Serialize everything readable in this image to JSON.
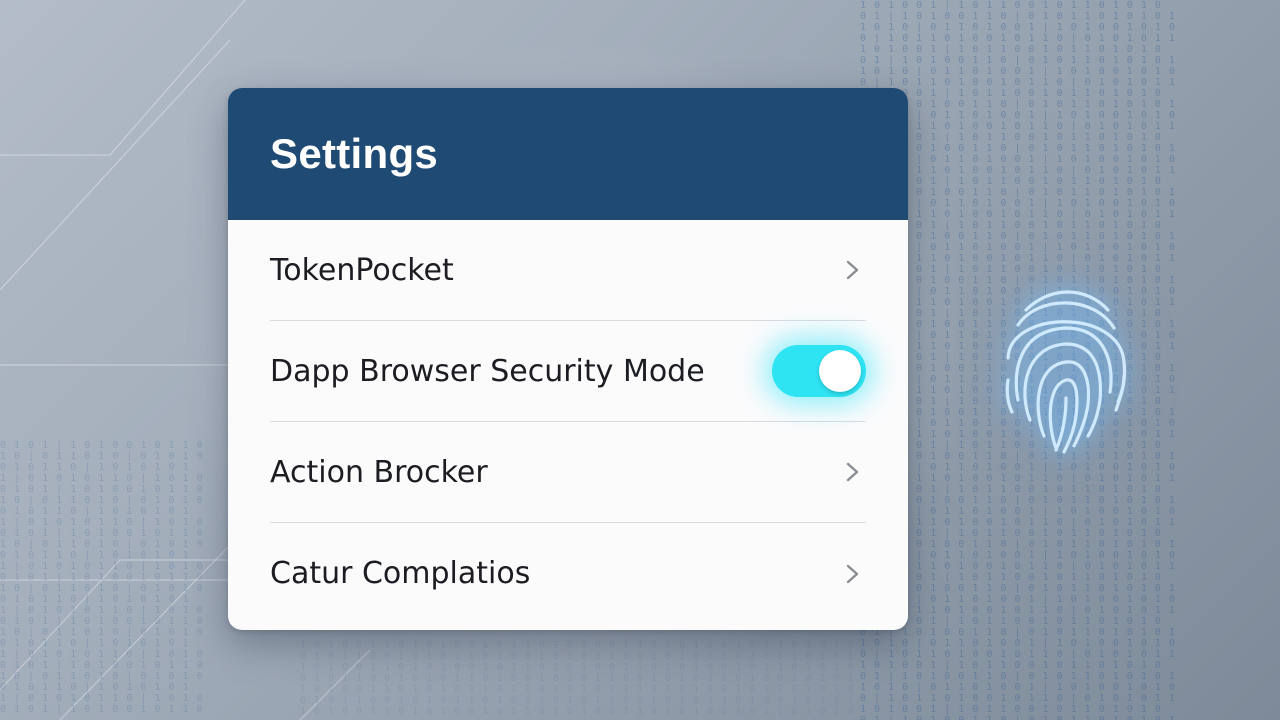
{
  "settings": {
    "title": "Settings",
    "items": [
      {
        "label": "TokenPocket",
        "control": "chevron"
      },
      {
        "label": "Dapp Browser Security Mode",
        "control": "toggle",
        "toggle_on": true
      },
      {
        "label": "Action Brocker",
        "control": "chevron"
      },
      {
        "label": "Catur Complatios",
        "control": "chevron"
      }
    ]
  },
  "colors": {
    "header": "#1f4a74",
    "toggle_on": "#2ee4f3",
    "fingerprint_glow": "#8fd0ff"
  },
  "icons": {
    "chevron": "chevron-right-icon",
    "fingerprint": "fingerprint-icon"
  }
}
